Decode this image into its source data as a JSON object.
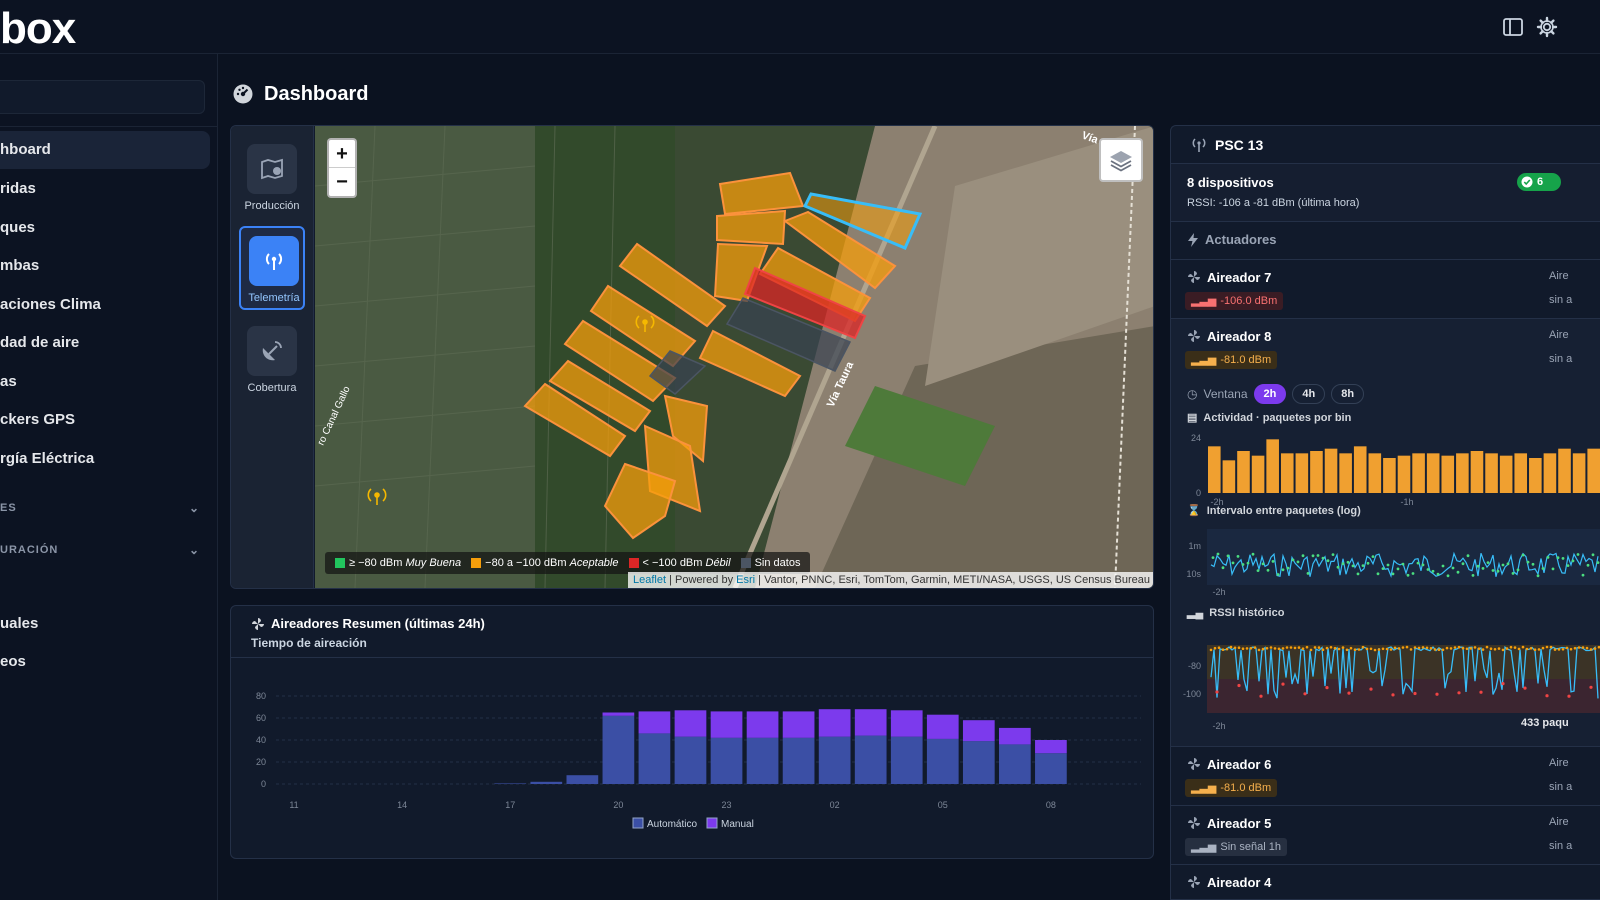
{
  "header": {
    "logo_text": "box"
  },
  "sidebar": {
    "items": [
      {
        "label": "hboard",
        "active": true
      },
      {
        "label": "ridas"
      },
      {
        "label": "ques"
      },
      {
        "label": "mbas"
      },
      {
        "label": "aciones Clima"
      },
      {
        "label": "dad de aire"
      },
      {
        "label": "as"
      },
      {
        "label": "ckers GPS"
      },
      {
        "label": "rgía Eléctrica"
      }
    ],
    "sections": [
      {
        "label": "ES"
      },
      {
        "label": "URACIÓN"
      }
    ],
    "bottom_items": [
      {
        "label": "uales"
      },
      {
        "label": "eos"
      }
    ]
  },
  "page": {
    "title": "Dashboard"
  },
  "map": {
    "tools": [
      {
        "label": "Producción",
        "icon": "map-pin-icon",
        "active": false
      },
      {
        "label": "Telemetría",
        "icon": "antenna-icon",
        "active": true
      },
      {
        "label": "Cobertura",
        "icon": "satellite-dish-icon",
        "active": false
      }
    ],
    "zoom_in": "+",
    "zoom_out": "−",
    "road_labels": [
      "Vía Taura",
      "Vía",
      "ro Canal Gallo"
    ],
    "legend": [
      {
        "color": "#22c55e",
        "text": "≥ −80 dBm",
        "quality": "Muy Buena"
      },
      {
        "color": "#f59e0b",
        "text": "−80 a −100 dBm",
        "quality": "Aceptable"
      },
      {
        "color": "#dc2626",
        "text": "< −100 dBm",
        "quality": "Débil"
      },
      {
        "color": "#4b5563",
        "text": "Sin datos",
        "quality": ""
      }
    ],
    "attribution": {
      "leaflet": "Leaflet",
      "powered": " | Powered by ",
      "esri": "Esri",
      "rest": " | Vantor, PNNC, Esri, TomTom, Garmin, METI/NASA, USGS, US Census Bureau"
    }
  },
  "summary": {
    "title": "Aireadores Resumen (últimas 24h)",
    "subtitle": "Tiempo de aireación"
  },
  "chart_data": [
    {
      "type": "bar",
      "stacked": true,
      "categories": [
        "11",
        "12",
        "13",
        "14",
        "15",
        "16",
        "17",
        "18",
        "19",
        "20",
        "21",
        "22",
        "23",
        "24",
        "01",
        "02",
        "03",
        "04",
        "05",
        "06",
        "07",
        "08",
        "09",
        "10"
      ],
      "tick_labels": [
        "11",
        "14",
        "17",
        "20",
        "23",
        "02",
        "05",
        "08"
      ],
      "series": [
        {
          "name": "Automático",
          "color": "#3b4fa5",
          "values": [
            0,
            0,
            0,
            0,
            0,
            0,
            0.5,
            2,
            8,
            62,
            46,
            43,
            42,
            42,
            42,
            43,
            44,
            43,
            41,
            39,
            36,
            28,
            0,
            0
          ]
        },
        {
          "name": "Manual",
          "color": "#7c3aed",
          "values": [
            0,
            0,
            0,
            0,
            0,
            0,
            0,
            0,
            0,
            3,
            20,
            24,
            24,
            24,
            24,
            25,
            24,
            24,
            22,
            19,
            15,
            12,
            0,
            0
          ]
        }
      ],
      "ylim": [
        0,
        80
      ],
      "yticks": [
        0,
        20,
        40,
        60,
        80
      ],
      "grid": true,
      "legend": "bottom"
    }
  ],
  "right_panel": {
    "title": "PSC 13",
    "devices_label": "8 dispositivos",
    "rssi_summary": "RSSI: -106 a -81 dBm (última hora)",
    "ok_count": "6",
    "section_label": "Actuadores",
    "devices": [
      {
        "name": "Aireador 7",
        "rssi": "-106.0 dBm",
        "level": "red",
        "r1": "Aire",
        "r2": "sin a"
      },
      {
        "name": "Aireador 8",
        "rssi": "-81.0 dBm",
        "level": "amber",
        "r1": "Aire",
        "r2": "sin a"
      },
      {
        "name": "Aireador 6",
        "rssi": "-81.0 dBm",
        "level": "amber",
        "r1": "Aire",
        "r2": "sin a"
      },
      {
        "name": "Aireador 5",
        "rssi": "Sin señal 1h",
        "level": "gray",
        "r1": "Aire",
        "r2": "sin a"
      },
      {
        "name": "Aireador 4",
        "rssi": "",
        "level": "gray",
        "r1": "",
        "r2": ""
      }
    ],
    "window_label": "Ventana",
    "windows": [
      "2h",
      "4h",
      "8h"
    ],
    "window_selected": "2h",
    "activity_label": "Actividad · paquetes por bin",
    "activity_yticks": [
      "24",
      "0"
    ],
    "activity_xticks": [
      "-2h",
      "-1h"
    ],
    "activity_bars": [
      20,
      14,
      18,
      16,
      23,
      17,
      17,
      18,
      19,
      17,
      20,
      17,
      15,
      16,
      17,
      17,
      16,
      17,
      18,
      17,
      16,
      17,
      15,
      17,
      19,
      17,
      19
    ],
    "interval_label": "Intervalo entre paquetes (log)",
    "interval_yticks": [
      "1m",
      "10s"
    ],
    "interval_xticks": [
      "-2h"
    ],
    "rssi_label": "RSSI histórico",
    "rssi_yticks": [
      "-80",
      "-100"
    ],
    "rssi_xticks": [
      "-2h"
    ],
    "packets_text": "433 paqu"
  }
}
